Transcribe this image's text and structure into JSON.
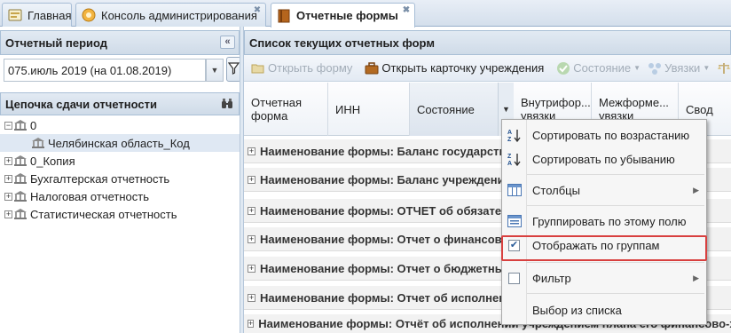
{
  "tabs": [
    {
      "label": "Главная",
      "icon": "home-icon"
    },
    {
      "label": "Консоль администрирования",
      "icon": "console-icon"
    },
    {
      "label": "Отчетные формы",
      "icon": "book-icon"
    }
  ],
  "left": {
    "period_title": "Отчетный период",
    "period_value": "075.июль 2019 (на 01.08.2019)",
    "chain_title": "Цепочка сдачи отчетности",
    "tree": [
      {
        "label": "0",
        "level": 0,
        "expander": "−"
      },
      {
        "label": "Челябинская область_Код",
        "level": 1,
        "expander": ""
      },
      {
        "label": "0_Копия",
        "level": 0,
        "expander": "+"
      },
      {
        "label": "Бухгалтерская отчетность",
        "level": 0,
        "expander": "+"
      },
      {
        "label": "Налоговая отчетность",
        "level": 0,
        "expander": "+"
      },
      {
        "label": "Статистическая отчетность",
        "level": 0,
        "expander": "+"
      }
    ]
  },
  "right": {
    "title": "Список текущих отчетных форм",
    "toolbar": {
      "open_form": "Открыть форму",
      "open_card": "Открыть карточку учреждения",
      "state": "Состояние",
      "links": "Увязки"
    },
    "columns": [
      "Отчетная форма",
      "ИНН",
      "Состояние",
      "Внутрифор... увязки",
      "Межформе... увязки",
      "Свод"
    ],
    "rows": [
      "Наименование формы: Баланс государственного учреждения",
      "Наименование формы: Баланс учреждения по поступлениям и выбытиям",
      "Наименование формы: ОТЧЕТ об обязательствах учреждения",
      "Наименование формы: Отчет о финансовых результатах деятельности",
      "Наименование формы: Отчет о бюджетных обязательствах",
      "Наименование формы: Отчет об исполнении бюджета",
      "Наименование формы: Отчёт об исполнении учреждением плана его финансово-хозяйственной деятельности"
    ]
  },
  "menu": {
    "sort_asc": "Сортировать по возрастанию",
    "sort_desc": "Сортировать по убыванию",
    "columns": "Столбцы",
    "group_by": "Группировать по этому полю",
    "show_groups": "Отображать по группам",
    "filter": "Фильтр",
    "pick_list": "Выбор из списка",
    "show_groups_checked": true,
    "filter_checked": false
  },
  "colors": {
    "highlight": "#d8403f",
    "header_bg": "#d4dfec",
    "accent": "#2b5d9a"
  }
}
